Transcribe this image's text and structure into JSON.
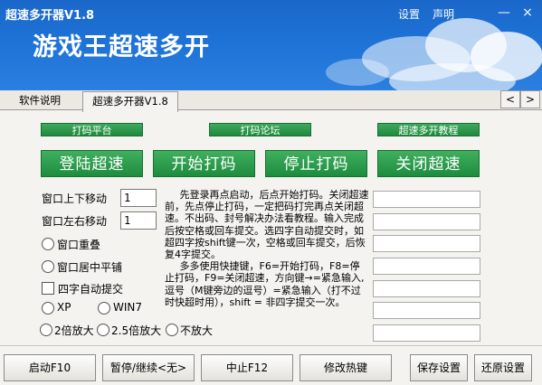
{
  "window": {
    "title": "超速多开器V1.8",
    "settings_label": "设置",
    "statement_label": "声明",
    "minimize_glyph": "—",
    "close_glyph": "×"
  },
  "banner": {
    "title": "游戏王超速多开"
  },
  "tabs": [
    {
      "label": "软件说明",
      "active": false
    },
    {
      "label": "超速多开器V1.8",
      "active": true
    }
  ],
  "tab_nav": {
    "prev": "<",
    "next": ">"
  },
  "top_links": [
    "打码平台",
    "打码论坛",
    "超速多开教程"
  ],
  "main_buttons": [
    "登陆超速",
    "开始打码",
    "停止打码",
    "关闭超速"
  ],
  "settings": {
    "vertical_move_label": "窗口上下移动",
    "vertical_move_value": "1",
    "horizontal_move_label": "窗口左右移动",
    "horizontal_move_value": "1",
    "overlap_label": "窗口重叠",
    "center_tile_label": "窗口居中平铺",
    "auto_submit_label": "四字自动提交",
    "xp_label": "XP",
    "win7_label": "WIN7",
    "zoom2_label": "2倍放大",
    "zoom25_label": "2.5倍放大",
    "nozoom_label": "不放大"
  },
  "instructions": [
    "先登录再点启动，后点开始打码。关闭超速前，先点停止打码，一定把码打完再点关闭超速。不出码、封号解决办法看教程。输入完成后按空格或回车提交。选四字自动提交时，如超四字按shift键一次，空格或回车提交，后恢复4字提交。",
    "多多使用快捷键，F6=开始打码，F8=停止打码，F9=关闭超速，方向键→=紧急输入,逗号（M键旁边的逗号）=紧急输入（打不过时快超时用），shift = 非四字提交一次。"
  ],
  "bottom_buttons": {
    "start": "启动F10",
    "pause": "暂停/继续<无>",
    "stop": "中止F12",
    "hotkey": "修改热键",
    "save": "保存设置",
    "restore": "还原设置"
  }
}
